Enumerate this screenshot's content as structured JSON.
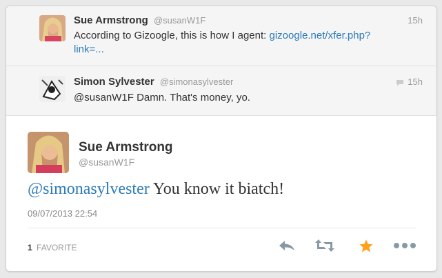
{
  "conversation": [
    {
      "name": "Sue Armstrong",
      "handle": "@susanW1F",
      "time": "15h",
      "text": "According to Gizoogle, this is how I agent:",
      "link": "gizoogle.net/xfer.php?link=..."
    },
    {
      "name": "Simon Sylvester",
      "handle": "@simonasylvester",
      "time": "15h",
      "text": "@susanW1F Damn. That's money, yo."
    }
  ],
  "main_tweet": {
    "name": "Sue Armstrong",
    "handle": "@susanW1F",
    "mention": "@simonasylvester",
    "text": " You know it biatch!",
    "date": "09/07/2013 22:54",
    "favorite_count": "1",
    "favorite_label": "FAVORITE"
  },
  "icons": [
    "reply-icon",
    "retweet-icon",
    "favorite-star-icon",
    "more-icon",
    "conversation-bubble-icon"
  ],
  "colors": {
    "link": "#2b7bb9",
    "star": "#ff9f1c",
    "action_icon": "#8899a6"
  }
}
